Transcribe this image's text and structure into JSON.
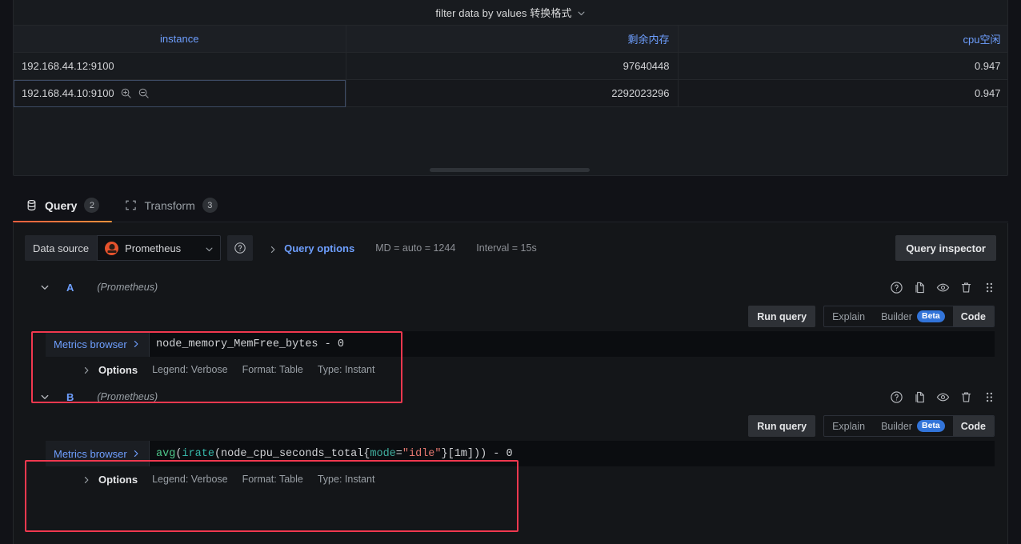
{
  "panel": {
    "title": "filter data by values 转换格式",
    "menu_icon": "chevron-down-icon",
    "table": {
      "columns": [
        {
          "label": "instance",
          "align": "left"
        },
        {
          "label": "剩余内存",
          "align": "right"
        },
        {
          "label": "cpu空闲",
          "align": "right"
        }
      ],
      "rows": [
        {
          "instance": "192.168.44.12:9100",
          "mem": "97640448",
          "cpu": "0.947",
          "selected": false,
          "show_filter_icons": false
        },
        {
          "instance": "192.168.44.10:9100",
          "mem": "2292023296",
          "cpu": "0.947",
          "selected": true,
          "show_filter_icons": true
        }
      ],
      "row_filter_icons": [
        "zoom-in-icon",
        "zoom-out-icon"
      ]
    }
  },
  "tabs": [
    {
      "id": "query",
      "label": "Query",
      "badge": "2",
      "icon": "database-icon",
      "active": true
    },
    {
      "id": "transform",
      "label": "Transform",
      "badge": "3",
      "icon": "transform-icon",
      "active": false
    }
  ],
  "datasource_row": {
    "label": "Data source",
    "selected": "Prometheus",
    "logo_icon": "prometheus-logo-icon",
    "dropdown_icon": "chevron-down-icon",
    "help_icon": "help-circle-icon",
    "query_options_label": "Query options",
    "query_options_caret": "chevron-right-icon",
    "meta": [
      "MD = auto = 1244",
      "Interval = 15s"
    ],
    "inspector_button": "Query inspector"
  },
  "queries": [
    {
      "ref": "A",
      "datasource": "(Prometheus)",
      "collapse_icon": "chevron-down-icon",
      "actions": [
        "help-circle-icon",
        "duplicate-icon",
        "eye-icon",
        "trash-icon",
        "drag-handle-icon"
      ],
      "run_label": "Run query",
      "explain_label": "Explain",
      "builder_label": "Builder",
      "beta_label": "Beta",
      "code_label": "Code",
      "mode": "code",
      "metrics_browser_label": "Metrics browser",
      "metrics_browser_caret": "chevron-right-icon",
      "expression_tokens": [
        {
          "t": "node_memory_MemFree_bytes",
          "c": "plain"
        },
        {
          "t": " - ",
          "c": "plain"
        },
        {
          "t": "0",
          "c": "num"
        }
      ],
      "expression_text": "node_memory_MemFree_bytes - 0",
      "options": {
        "caret": "chevron-right-icon",
        "title": "Options",
        "items": [
          "Legend: Verbose",
          "Format: Table",
          "Type: Instant"
        ]
      },
      "highlight": true
    },
    {
      "ref": "B",
      "datasource": "(Prometheus)",
      "collapse_icon": "chevron-down-icon",
      "actions": [
        "help-circle-icon",
        "duplicate-icon",
        "eye-icon",
        "trash-icon",
        "drag-handle-icon"
      ],
      "run_label": "Run query",
      "explain_label": "Explain",
      "builder_label": "Builder",
      "beta_label": "Beta",
      "code_label": "Code",
      "mode": "code",
      "metrics_browser_label": "Metrics browser",
      "metrics_browser_caret": "chevron-right-icon",
      "expression_tokens": [
        {
          "t": "avg",
          "c": "fn"
        },
        {
          "t": "(",
          "c": "plain"
        },
        {
          "t": "irate",
          "c": "fn2"
        },
        {
          "t": "(node_cpu_seconds_total{",
          "c": "plain"
        },
        {
          "t": "mode",
          "c": "lbl"
        },
        {
          "t": "=",
          "c": "plain"
        },
        {
          "t": "\"idle\"",
          "c": "str"
        },
        {
          "t": "}[1m])) - ",
          "c": "plain"
        },
        {
          "t": "0",
          "c": "num"
        }
      ],
      "expression_text": "avg(irate(node_cpu_seconds_total{mode=\"idle\"}[1m])) - 0",
      "options": {
        "caret": "chevron-right-icon",
        "title": "Options",
        "items": [
          "Legend: Verbose",
          "Format: Table",
          "Type: Instant"
        ]
      },
      "highlight": true
    }
  ],
  "colors": {
    "accent_blue": "#6e9fff",
    "beta_blue": "#3274d9",
    "tab_underline": "#f55f3e",
    "annotation_red": "#f0384f",
    "panel_bg": "#181b1f",
    "editor_bg": "#141619"
  }
}
